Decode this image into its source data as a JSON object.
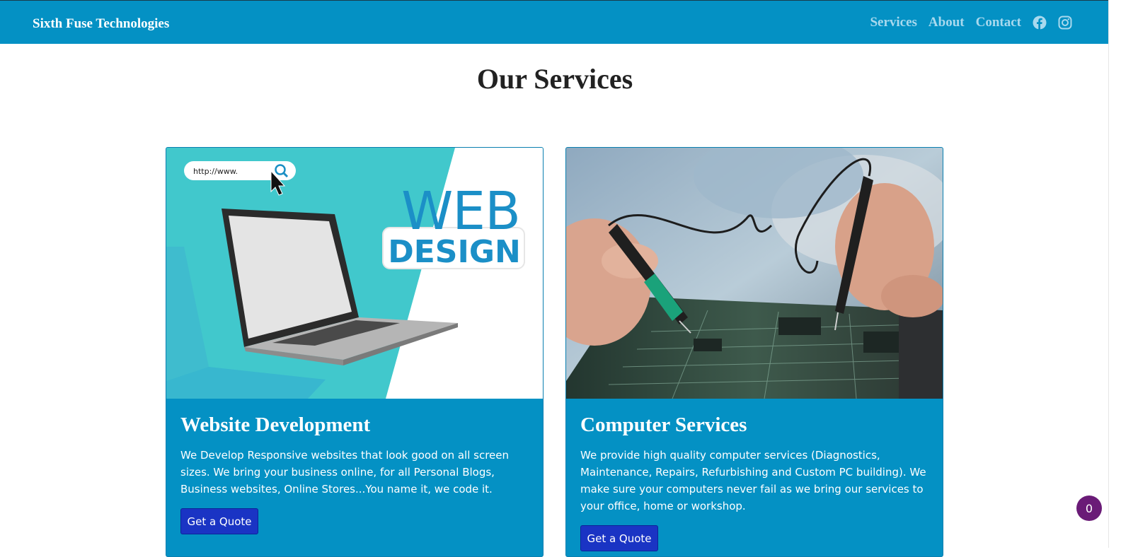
{
  "navbar": {
    "brand": "Sixth Fuse Technologies",
    "links": [
      "Services",
      "About",
      "Contact"
    ],
    "social_icons": [
      "facebook-icon",
      "instagram-icon"
    ]
  },
  "page": {
    "title": "Our Services"
  },
  "cards": [
    {
      "title": "Website Development",
      "description": "We Develop Responsive websites that look good on all screen sizes. We bring your business online, for all Personal Blogs, Business websites, Online Stores...You name it, we code it.",
      "button": "Get a Quote",
      "image": {
        "url_text": "http://www.",
        "headline_top": "WEB",
        "headline_bottom": "DESIGN"
      }
    },
    {
      "title": "Computer Services",
      "description": "We provide high quality computer services (Diagnostics, Maintenance, Repairs, Refurbishing and Custom PC building). We make sure your computers never fail as we bring our services to your office, home or workshop.",
      "button": "Get a Quote"
    }
  ],
  "floating_badge": {
    "count": "0"
  },
  "colors": {
    "primary": "#0491c4",
    "button": "#1a34c4",
    "badge": "#6a1b77",
    "nav_link": "#a9d9ee"
  }
}
